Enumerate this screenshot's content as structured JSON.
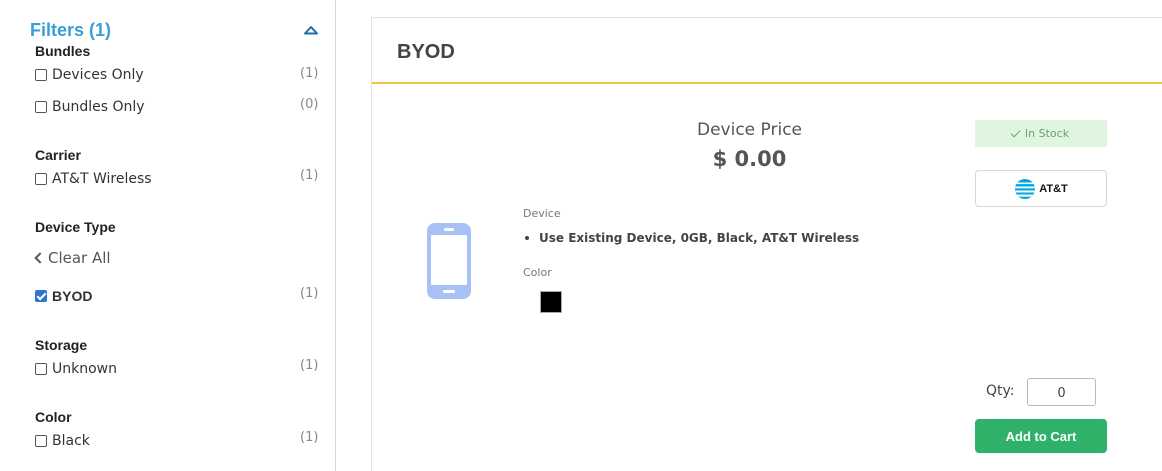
{
  "sidebar": {
    "title": "Filters (1)",
    "sections": {
      "bundles": {
        "title": "Bundles",
        "options": [
          {
            "label": "Devices Only",
            "count": "(1)",
            "checked": false
          },
          {
            "label": "Bundles Only",
            "count": "(0)",
            "checked": false
          }
        ]
      },
      "carrier": {
        "title": "Carrier",
        "options": [
          {
            "label": "AT&T Wireless",
            "count": "(1)",
            "checked": false
          }
        ]
      },
      "device_type": {
        "title": "Device Type",
        "clear_all": "Clear All",
        "options": [
          {
            "label": "BYOD",
            "count": "(1)",
            "checked": true
          }
        ]
      },
      "storage": {
        "title": "Storage",
        "options": [
          {
            "label": "Unknown",
            "count": "(1)",
            "checked": false
          }
        ]
      },
      "color": {
        "title": "Color",
        "options": [
          {
            "label": "Black",
            "count": "(1)",
            "checked": false
          }
        ]
      }
    }
  },
  "product": {
    "title": "BYOD",
    "price_label": "Device Price",
    "price_value": "$ 0.00",
    "device_label": "Device",
    "device_description": "Use Existing Device, 0GB, Black, AT&T Wireless",
    "color_label": "Color",
    "color_swatch": "#000000",
    "stock_status": "In Stock",
    "carrier_logo_text": "AT&T",
    "qty_label": "Qty:",
    "qty_value": "0",
    "add_to_cart_label": "Add to Cart"
  },
  "colors": {
    "accent_blue": "#3a9fd8",
    "header_underline": "#f5c242",
    "stock_bg": "#dff5e0",
    "cart_button": "#2fb16a",
    "phone_icon": "#a8c1f5"
  },
  "icons": {
    "collapse": "chevron-up-icon",
    "back": "chevron-left-icon",
    "phone": "smartphone-icon",
    "check": "checkmark-icon",
    "carrier": "att-globe-icon"
  }
}
